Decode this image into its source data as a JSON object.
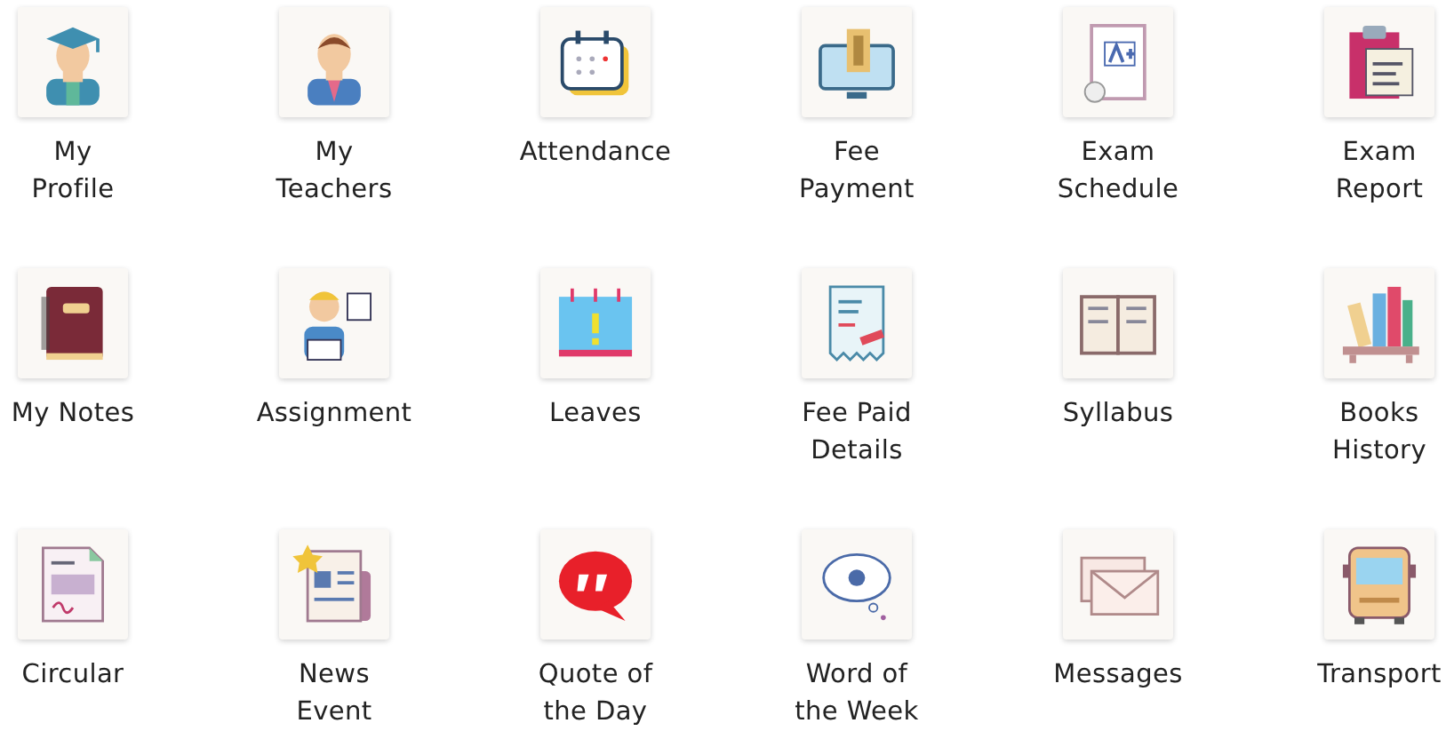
{
  "menu_items": [
    {
      "label": "My\nProfile"
    },
    {
      "label": "My\nTeachers"
    },
    {
      "label": "Attendance"
    },
    {
      "label": "Fee\nPayment"
    },
    {
      "label": "Exam\nSchedule"
    },
    {
      "label": "Exam\nReport"
    },
    {
      "label": "My Notes"
    },
    {
      "label": "Assignment"
    },
    {
      "label": "Leaves"
    },
    {
      "label": "Fee Paid\nDetails"
    },
    {
      "label": "Syllabus"
    },
    {
      "label": "Books\nHistory"
    },
    {
      "label": "Circular"
    },
    {
      "label": "News\nEvent"
    },
    {
      "label": "Quote of\nthe Day"
    },
    {
      "label": "Word of\nthe Week"
    },
    {
      "label": "Messages"
    },
    {
      "label": "Transport"
    }
  ]
}
